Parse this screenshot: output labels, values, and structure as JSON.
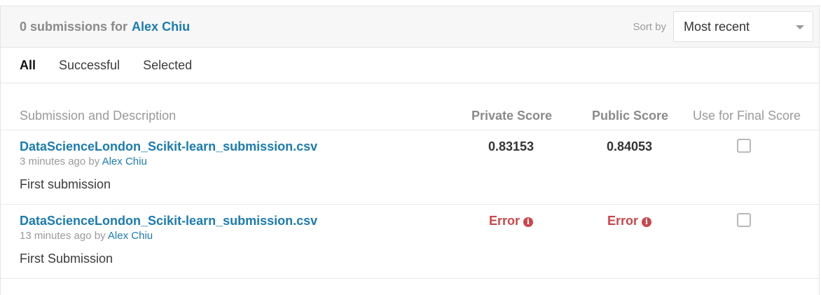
{
  "header": {
    "count_text": "0 submissions for",
    "user_name": "Alex Chiu",
    "sort_label": "Sort by",
    "sort_value": "Most recent"
  },
  "tabs": [
    {
      "label": "All",
      "active": true
    },
    {
      "label": "Successful",
      "active": false
    },
    {
      "label": "Selected",
      "active": false
    }
  ],
  "table": {
    "columns": {
      "description": "Submission and Description",
      "private": "Private Score",
      "public": "Public Score",
      "final": "Use for Final Score"
    },
    "rows": [
      {
        "file": "DataScienceLondon_Scikit-learn_submission.csv",
        "time": "3 minutes ago by",
        "user": "Alex Chiu",
        "description": "First submission",
        "private_score": "0.83153",
        "public_score": "0.84053",
        "checked": false
      },
      {
        "file": "DataScienceLondon_Scikit-learn_submission.csv",
        "time": "13 minutes ago by",
        "user": "Alex Chiu",
        "description": "First Submission",
        "private_score": "Error",
        "public_score": "Error",
        "checked": false
      }
    ]
  }
}
